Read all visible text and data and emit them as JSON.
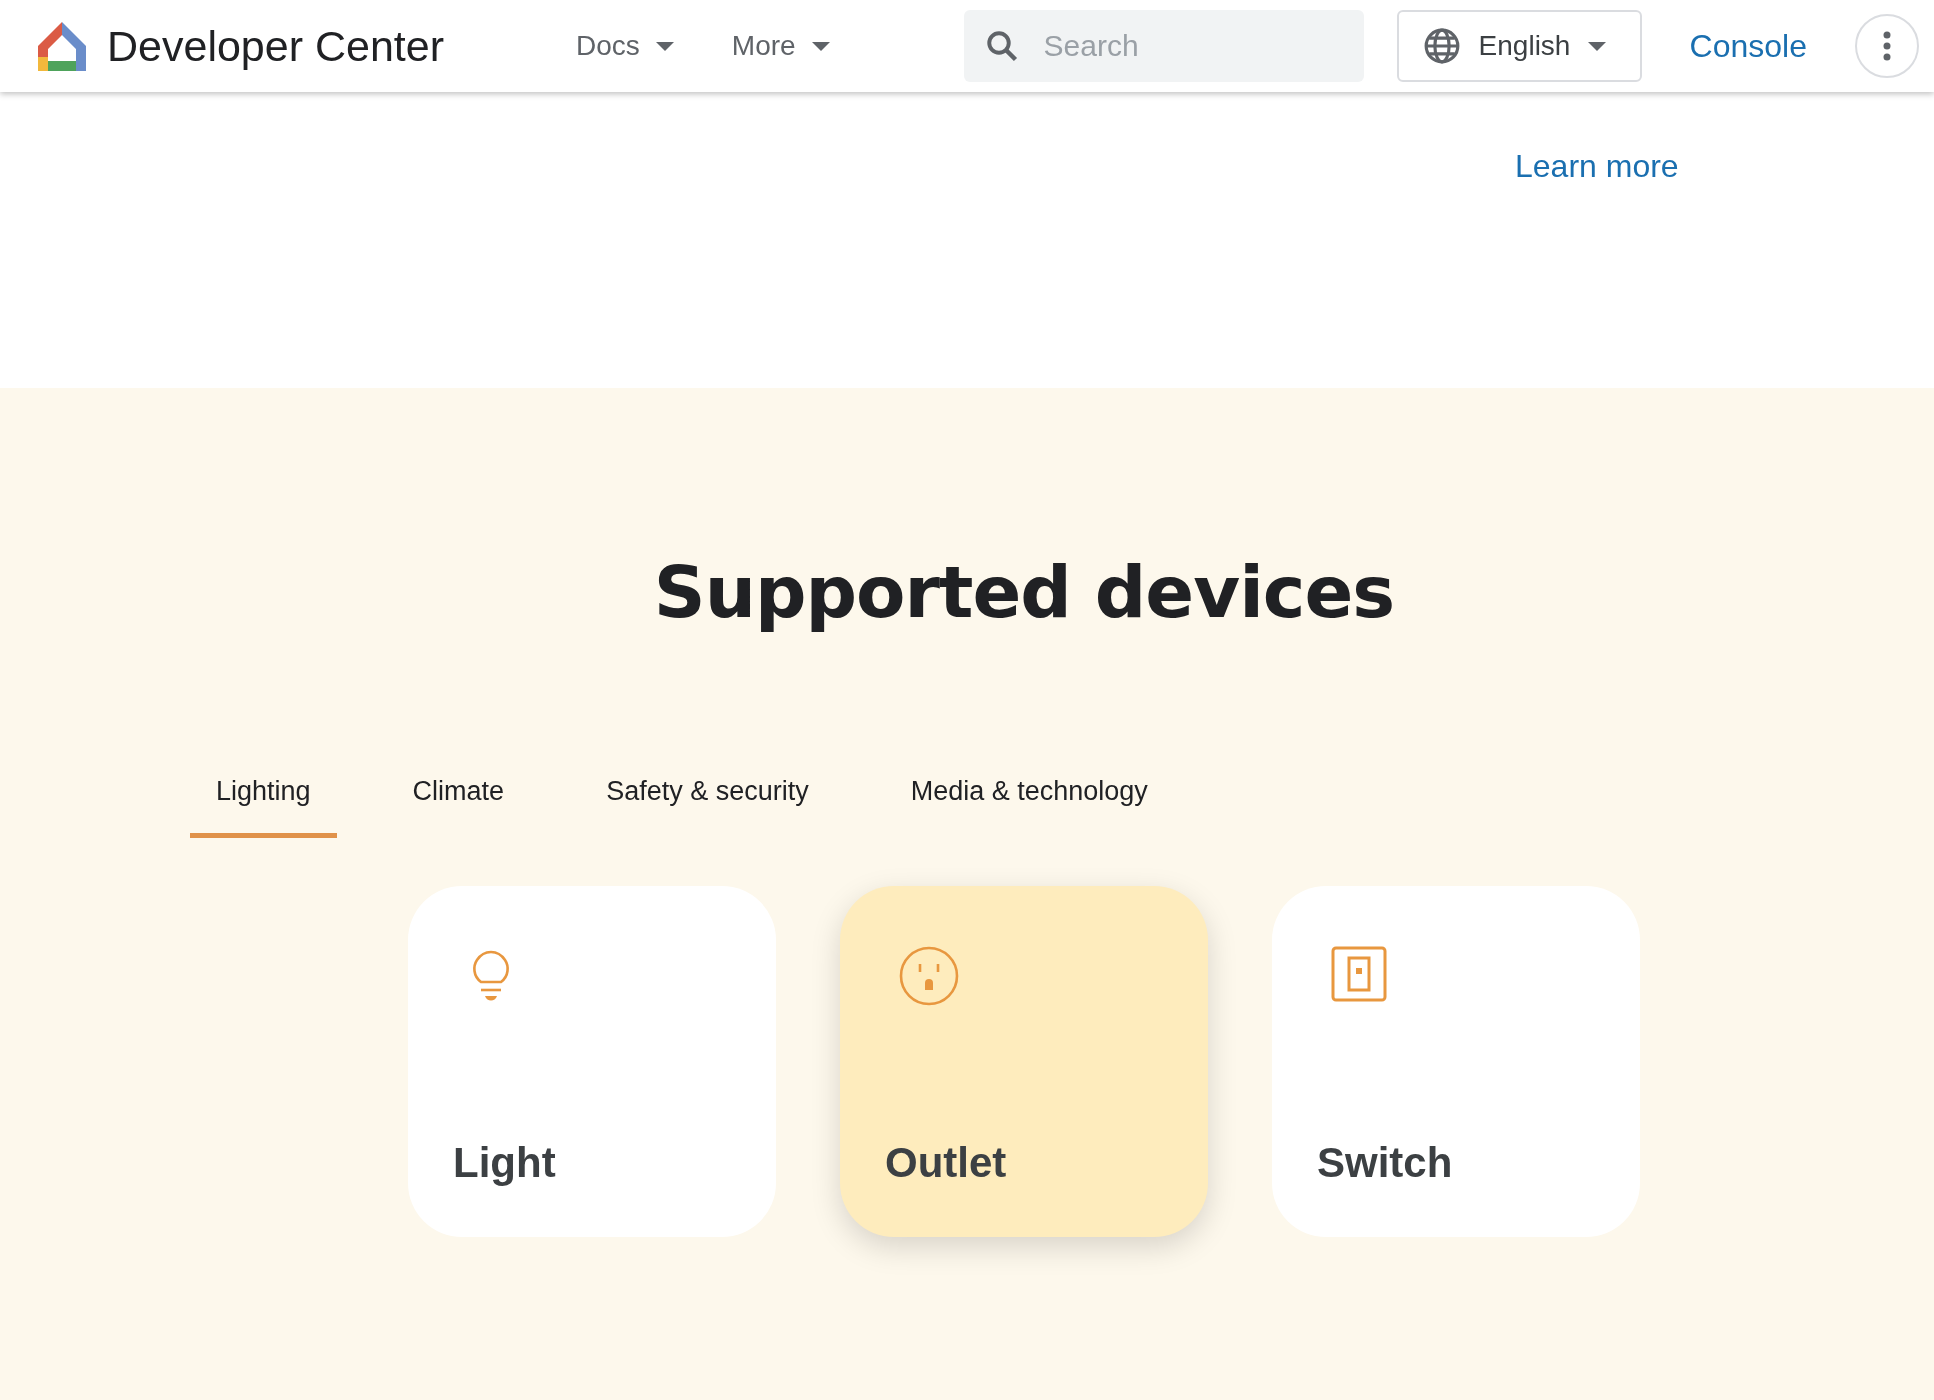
{
  "header": {
    "title": "Developer Center",
    "nav": [
      {
        "label": "Docs"
      },
      {
        "label": "More"
      }
    ],
    "search": {
      "placeholder": "Search"
    },
    "language": "English",
    "console": "Console"
  },
  "intro": {
    "link": "Learn more"
  },
  "devices": {
    "heading": "Supported devices",
    "tabs": [
      {
        "label": "Lighting",
        "selected": true
      },
      {
        "label": "Climate",
        "selected": false
      },
      {
        "label": "Safety & security",
        "selected": false
      },
      {
        "label": "Media & technology",
        "selected": false
      }
    ],
    "cards": [
      {
        "kind": "light",
        "label": "Light",
        "selected": false
      },
      {
        "kind": "outlet",
        "label": "Outlet",
        "selected": true
      },
      {
        "kind": "switch",
        "label": "Switch",
        "selected": false
      }
    ]
  }
}
